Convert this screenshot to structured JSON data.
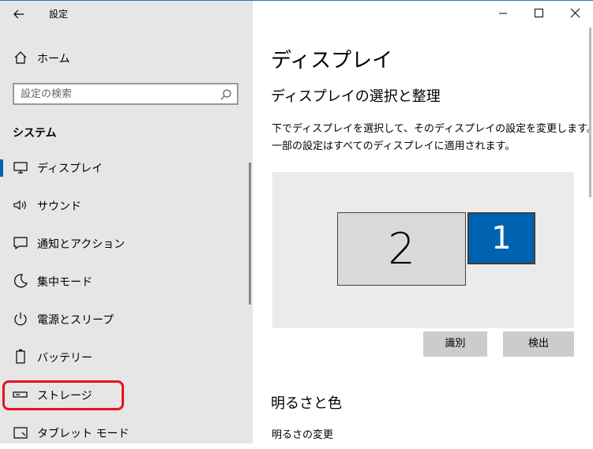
{
  "window": {
    "title": "設定"
  },
  "sidebar": {
    "home_label": "ホーム",
    "search_placeholder": "設定の検索",
    "section_header": "システム",
    "items": [
      {
        "label": "ディスプレイ",
        "icon": "monitor-icon",
        "selected": true
      },
      {
        "label": "サウンド",
        "icon": "speaker-icon"
      },
      {
        "label": "通知とアクション",
        "icon": "message-icon"
      },
      {
        "label": "集中モード",
        "icon": "moon-icon"
      },
      {
        "label": "電源とスリープ",
        "icon": "power-icon"
      },
      {
        "label": "バッテリー",
        "icon": "battery-icon"
      },
      {
        "label": "ストレージ",
        "icon": "storage-icon",
        "highlighted": true
      },
      {
        "label": "タブレット モード",
        "icon": "tablet-icon"
      }
    ]
  },
  "main": {
    "title": "ディスプレイ",
    "arrange_header": "ディスプレイの選択と整理",
    "description_line1": "下でディスプレイを選択して、そのディスプレイの設定を変更します。",
    "description_line2": "一部の設定はすべてのディスプレイに適用されます。",
    "displays": [
      {
        "number": "2",
        "selected": false
      },
      {
        "number": "1",
        "selected": true
      }
    ],
    "identify_button": "識別",
    "detect_button": "検出",
    "brightness_header": "明るさと色",
    "brightness_change": "明るさの変更"
  },
  "colors": {
    "accent": "#0063b1",
    "highlight_border": "#e81123",
    "sidebar_bg": "#e6e6e6"
  }
}
